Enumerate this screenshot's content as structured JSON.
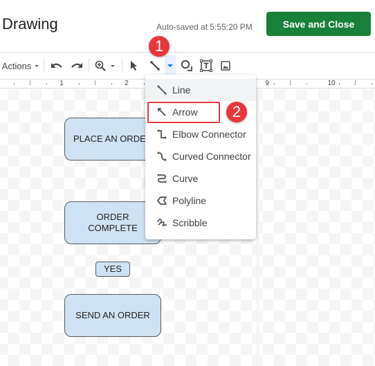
{
  "header": {
    "title": "Drawing",
    "autosave": "Auto-saved at 5:55:20 PM",
    "save_button": "Save and Close"
  },
  "toolbar": {
    "actions_label": "Actions",
    "items": [
      "actions-menu",
      "undo",
      "redo",
      "zoom",
      "select",
      "line",
      "line-dropdown",
      "shape",
      "text-box",
      "image"
    ]
  },
  "ruler": {
    "labels": [
      "1",
      "2",
      "9",
      "10"
    ]
  },
  "menu": {
    "items": [
      {
        "label": "Line",
        "icon": "line-icon"
      },
      {
        "label": "Arrow",
        "icon": "arrow-icon"
      },
      {
        "label": "Elbow Connector",
        "icon": "elbow-connector-icon"
      },
      {
        "label": "Curved Connector",
        "icon": "curved-connector-icon"
      },
      {
        "label": "Curve",
        "icon": "curve-icon"
      },
      {
        "label": "Polyline",
        "icon": "polyline-icon"
      },
      {
        "label": "Scribble",
        "icon": "scribble-icon"
      }
    ]
  },
  "annotations": {
    "step1": "1",
    "step2": "2"
  },
  "shapes": {
    "place_order": "PLACE AN ORDER",
    "order_complete_1": "ORDER",
    "order_complete_2": "COMPLETE",
    "yes": "YES",
    "send_order": "SEND AN ORDER"
  },
  "colors": {
    "save_button": "#188038",
    "shape_fill": "#cfe2f3",
    "annotation_red": "#e8363d",
    "active_blue": "#1a73e8"
  }
}
